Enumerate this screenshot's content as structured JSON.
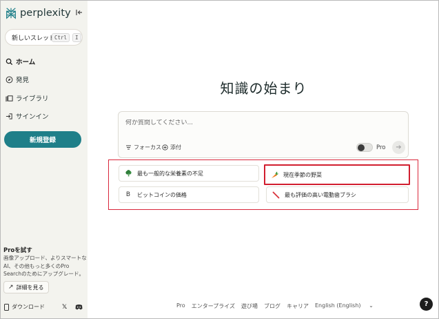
{
  "app": {
    "logo_text": "perplexity"
  },
  "sidebar": {
    "new_thread_label": "新しいスレッド",
    "shortcut_ctrl": "Ctrl",
    "shortcut_key": "I",
    "nav": [
      {
        "label": "ホーム",
        "icon": "search-icon",
        "active": true
      },
      {
        "label": "発見",
        "icon": "compass-icon"
      },
      {
        "label": "ライブラリ",
        "icon": "library-icon"
      },
      {
        "label": "サインイン",
        "icon": "signin-icon"
      }
    ],
    "signup_label": "新規登録",
    "pro_title": "Proを試す",
    "pro_desc": "画像アップロード、よりスマートなAI、その他もっと多くのPro Searchのためにアップグレード。",
    "learn_more_label": "詳細を見る",
    "download_label": "ダウンロード"
  },
  "main": {
    "title": "知識の始まり",
    "search_placeholder": "何か質問してください...",
    "focus_label": "フォーカス",
    "attach_label": "添付",
    "pro_toggle_label": "Pro",
    "suggestions": [
      {
        "label": "最も一般的な栄養素の不足",
        "icon": "broccoli-icon"
      },
      {
        "label": "現在季節の野菜",
        "icon": "carrot-icon"
      },
      {
        "label": "ビットコインの価格",
        "icon": "bitcoin-icon"
      },
      {
        "label": "最も評価の高い電動歯ブラシ",
        "icon": "toothbrush-icon"
      }
    ]
  },
  "footer": {
    "links": [
      "Pro",
      "エンタープライズ",
      "遊び場",
      "ブログ",
      "キャリア",
      "English (English)"
    ],
    "help_label": "?"
  },
  "colors": {
    "accent": "#1f7f89",
    "highlight": "#d11d2e"
  }
}
